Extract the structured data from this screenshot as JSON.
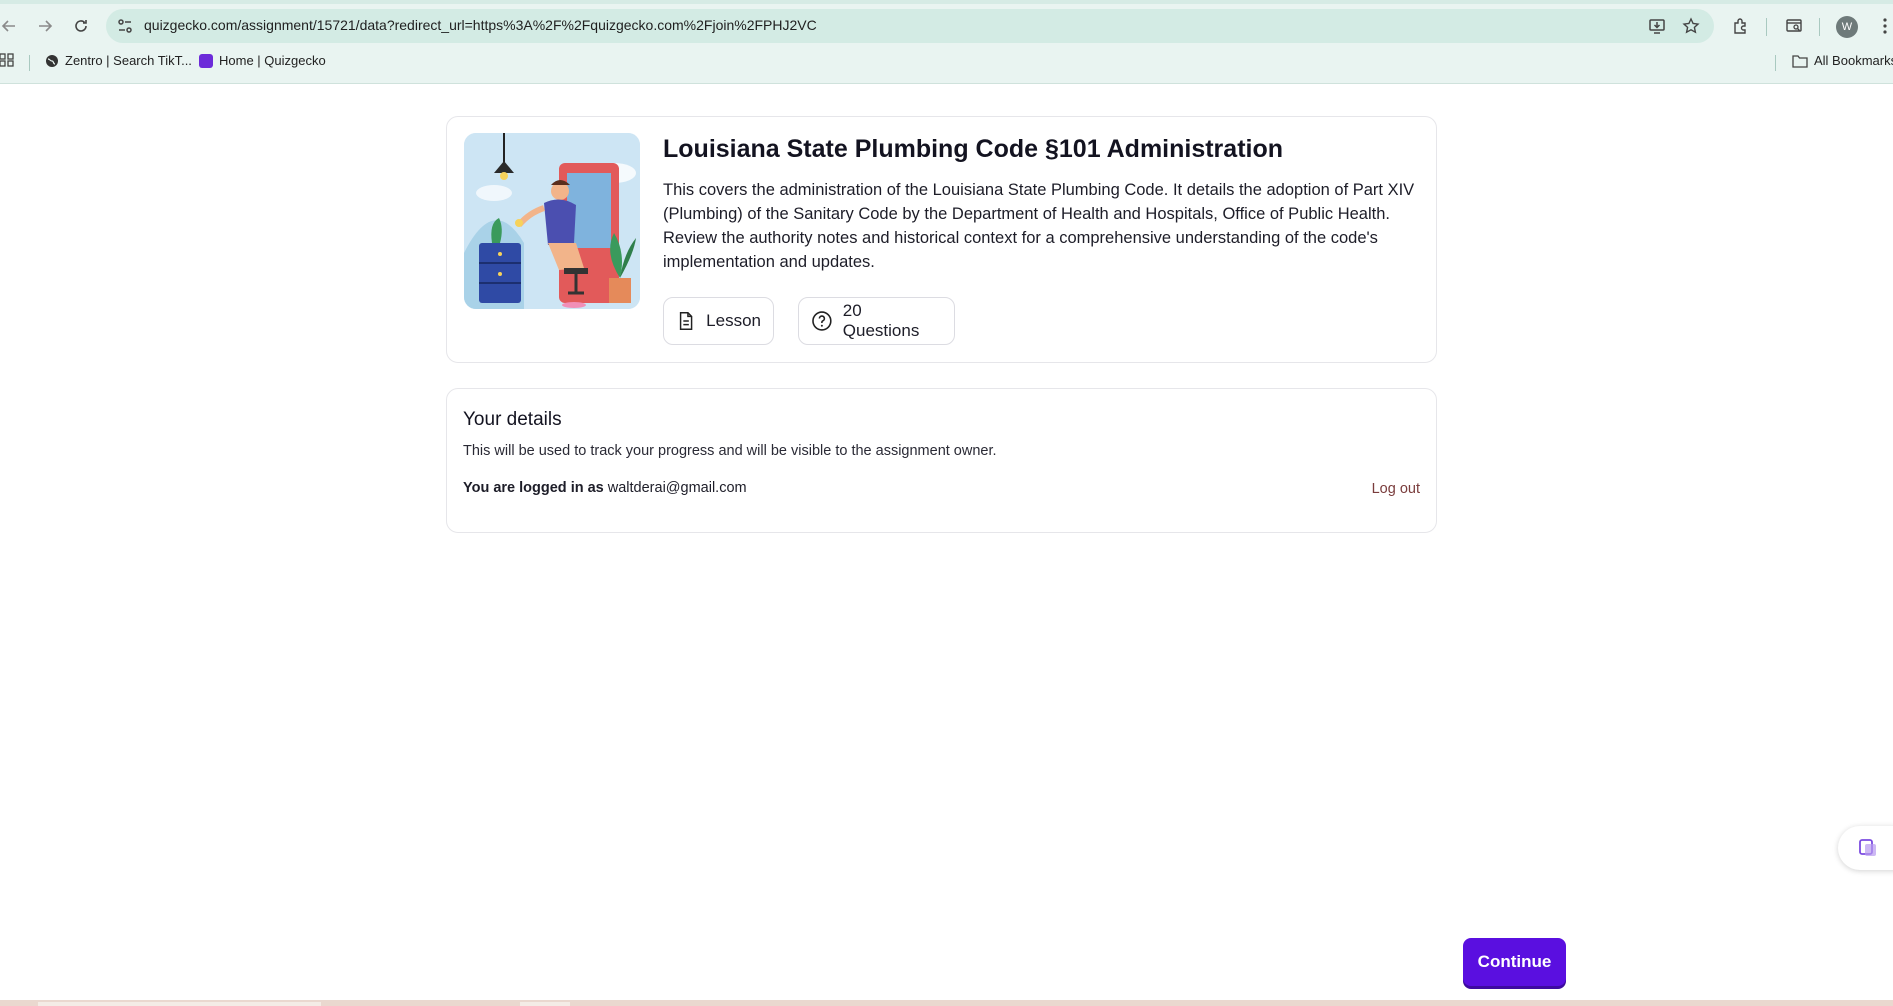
{
  "browser": {
    "url": "quizgecko.com/assignment/15721/data?redirect_url=https%3A%2F%2Fquizgecko.com%2Fjoin%2FPHJ2VC",
    "profile_initial": "W",
    "bookmarks": [
      {
        "label": "Zentro | Search TikT...",
        "icon": "globe-icon"
      },
      {
        "label": "Home | Quizgecko",
        "icon": "quizgecko-favicon"
      }
    ],
    "all_bookmarks_label": "All Bookmarks"
  },
  "assignment": {
    "title": "Louisiana State Plumbing Code §101 Administration",
    "description": "This covers the administration of the Louisiana State Plumbing Code. It details the adoption of Part XIV (Plumbing) of the Sanitary Code by the Department of Health and Hospitals, Office of Public Health. Review the authority notes and historical context for a comprehensive understanding of the code's implementation and updates.",
    "chips": {
      "lesson": "Lesson",
      "questions": "20 Questions"
    }
  },
  "details": {
    "title": "Your details",
    "subtitle": "This will be used to track your progress and will be visible to the assignment owner.",
    "logged_in_label": "You are logged in as",
    "email": "waltderai@gmail.com",
    "logout_label": "Log out"
  },
  "actions": {
    "continue_label": "Continue"
  },
  "colors": {
    "accent": "#5a0fe0",
    "chrome_bg": "#e9f4f1",
    "logout": "#7a3c3c"
  }
}
